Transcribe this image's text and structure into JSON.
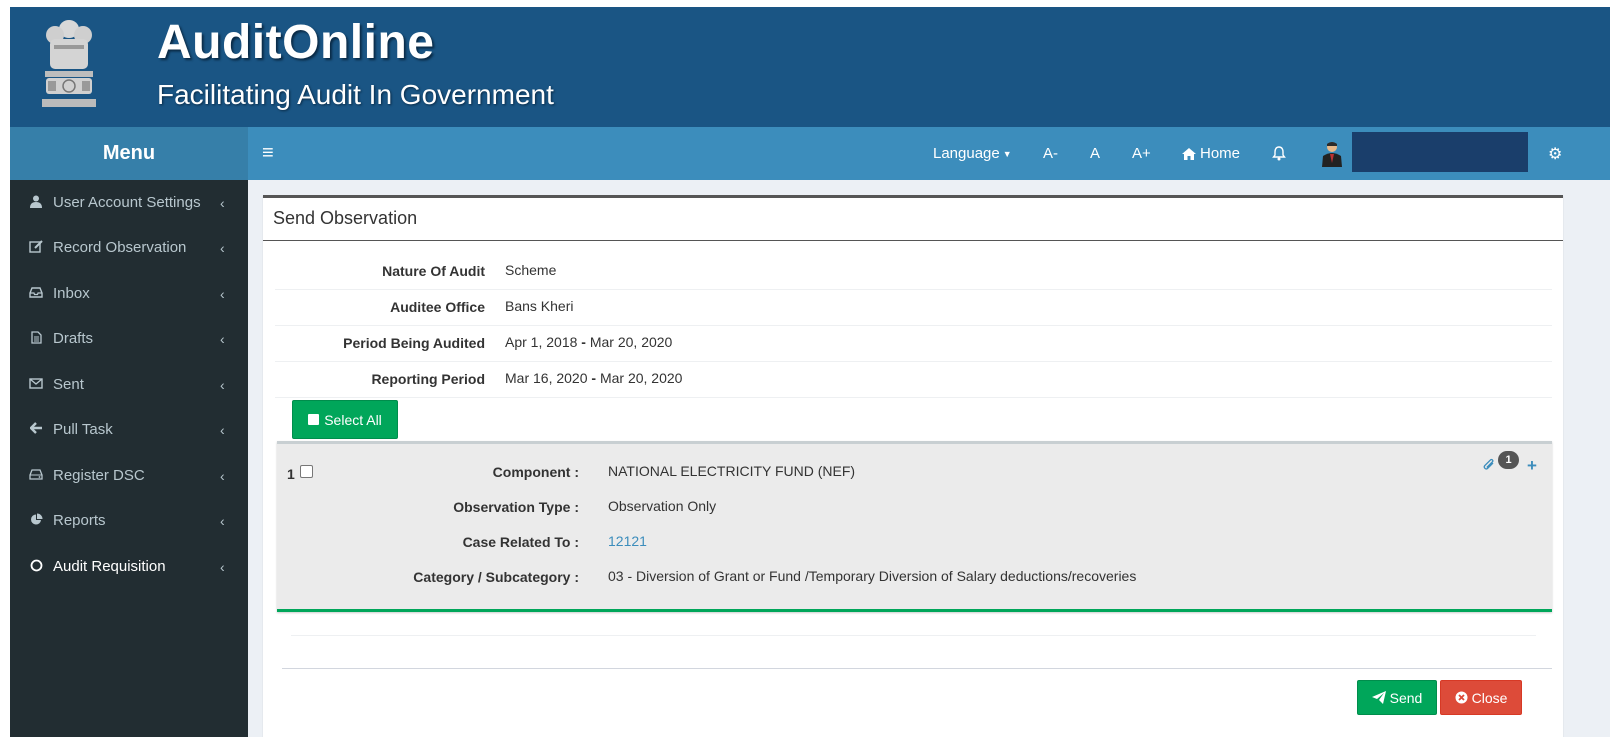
{
  "header": {
    "app_title": "AuditOnline",
    "tagline": "Facilitating Audit In Government",
    "emblem_icon": "national-emblem-icon"
  },
  "navbar": {
    "menu_title": "Menu",
    "language": "Language",
    "font_decrease": "A-",
    "font_normal": "A",
    "font_increase": "A+",
    "home": "Home",
    "icons": [
      "hamburger-icon",
      "home-icon",
      "bell-icon",
      "user-avatar-icon",
      "gears-icon"
    ]
  },
  "sidebar": {
    "items": [
      {
        "label": "User Account Settings",
        "icon": "user-icon"
      },
      {
        "label": "Record Observation",
        "icon": "edit-icon"
      },
      {
        "label": "Inbox",
        "icon": "inbox-icon"
      },
      {
        "label": "Drafts",
        "icon": "file-icon"
      },
      {
        "label": "Sent",
        "icon": "envelope-icon"
      },
      {
        "label": "Pull Task",
        "icon": "arrow-left-icon"
      },
      {
        "label": "Register DSC",
        "icon": "drive-icon"
      },
      {
        "label": "Reports",
        "icon": "pie-chart-icon"
      },
      {
        "label": "Audit Requisition",
        "icon": "circle-icon"
      }
    ]
  },
  "main": {
    "title": "Send Observation",
    "info": [
      {
        "label": "Nature Of Audit",
        "value": "Scheme"
      },
      {
        "label": "Auditee Office",
        "value": "Bans Kheri"
      },
      {
        "label": "Period Being Audited",
        "value_from": "Apr 1, 2018",
        "sep": "-",
        "value_to": "Mar 20, 2020"
      },
      {
        "label": "Reporting Period",
        "value_from": "Mar 16, 2020",
        "sep": "-",
        "value_to": "Mar 20, 2020"
      }
    ],
    "select_all": "Select All",
    "observation": {
      "number": "1",
      "attachment_count": "1",
      "fields": [
        {
          "label": "Component :",
          "value": "NATIONAL ELECTRICITY FUND (NEF)"
        },
        {
          "label": "Observation Type :",
          "value": "Observation Only"
        },
        {
          "label": "Case Related To :",
          "value": "12121"
        },
        {
          "label": "Category / Subcategory :",
          "value": "03 - Diversion of Grant or Fund /Temporary Diversion of Salary deductions/recoveries"
        }
      ]
    },
    "send": "Send",
    "close": "Close"
  },
  "colors": {
    "banner": "#1a5584",
    "navbar": "#3c8dbc",
    "sidebar": "#222d32",
    "success": "#00a65a",
    "danger": "#dd4b39"
  }
}
